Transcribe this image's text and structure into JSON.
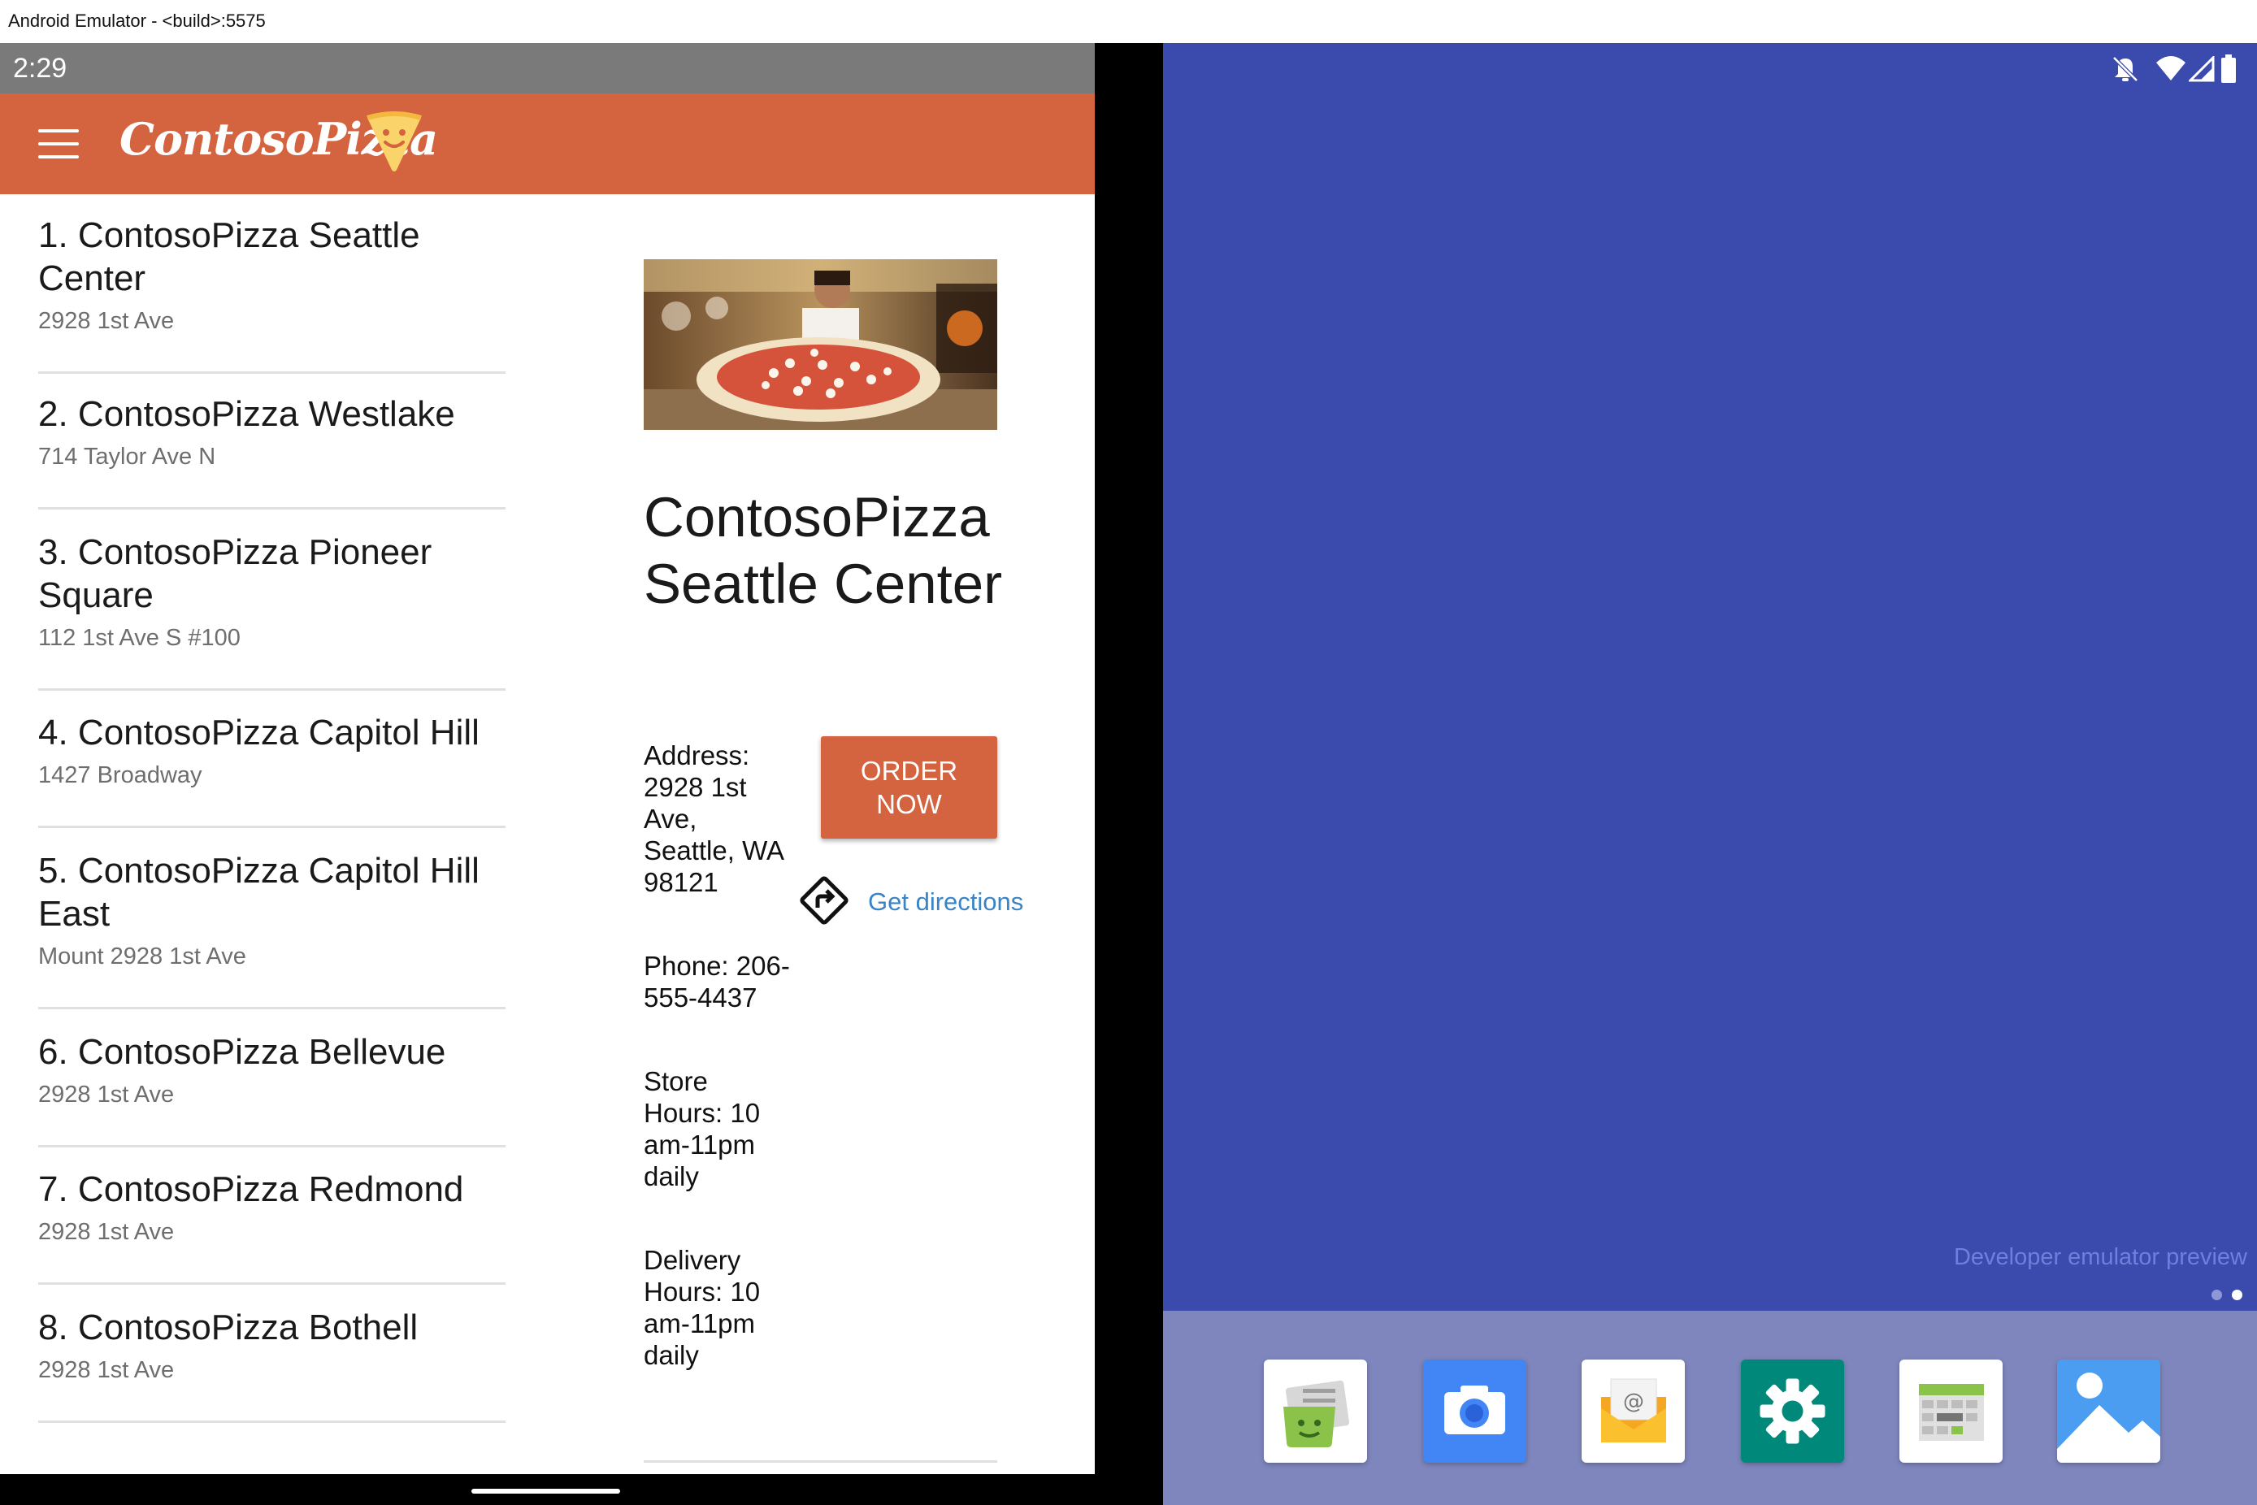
{
  "window": {
    "title": "Android Emulator - <build>:5575"
  },
  "left_status": {
    "time": "2:29"
  },
  "app": {
    "brand": "ContosoPizza"
  },
  "stores": [
    {
      "name": "1. ContosoPizza Seattle Center",
      "address": "2928 1st Ave"
    },
    {
      "name": "2. ContosoPizza Westlake",
      "address": "714 Taylor Ave N"
    },
    {
      "name": "3. ContosoPizza Pioneer Square",
      "address": "112 1st Ave S #100"
    },
    {
      "name": "4. ContosoPizza Capitol Hill",
      "address": "1427 Broadway"
    },
    {
      "name": "5. ContosoPizza Capitol Hill East",
      "address": "Mount 2928 1st Ave"
    },
    {
      "name": "6. ContosoPizza Bellevue",
      "address": "2928 1st Ave"
    },
    {
      "name": "7. ContosoPizza Redmond",
      "address": "2928 1st Ave"
    },
    {
      "name": "8. ContosoPizza Bothell",
      "address": "2928 1st Ave"
    }
  ],
  "detail": {
    "title": "ContosoPizza Seattle Center",
    "address": "Address: 2928 1st Ave, Seattle, WA 98121",
    "phone": "Phone: 206-555-4437",
    "store_hours": "Store Hours: 10 am-11pm daily",
    "delivery_hours": "Delivery Hours: 10 am-11pm daily",
    "order_button": "ORDER NOW",
    "directions_link": "Get directions"
  },
  "right_screen": {
    "preview_text": "Developer emulator preview",
    "status_icons": [
      "notifications-off-icon",
      "wifi-icon",
      "cellular-signal-icon",
      "battery-icon"
    ],
    "dock_apps": [
      "messaging-app-icon",
      "camera-app-icon",
      "email-app-icon",
      "settings-app-icon",
      "calendar-app-icon",
      "photos-app-icon"
    ]
  },
  "colors": {
    "brand_orange": "#d4633f",
    "link_blue": "#3a84c5",
    "right_wallpaper": "#3a4aad",
    "dock": "#7e86bd"
  }
}
